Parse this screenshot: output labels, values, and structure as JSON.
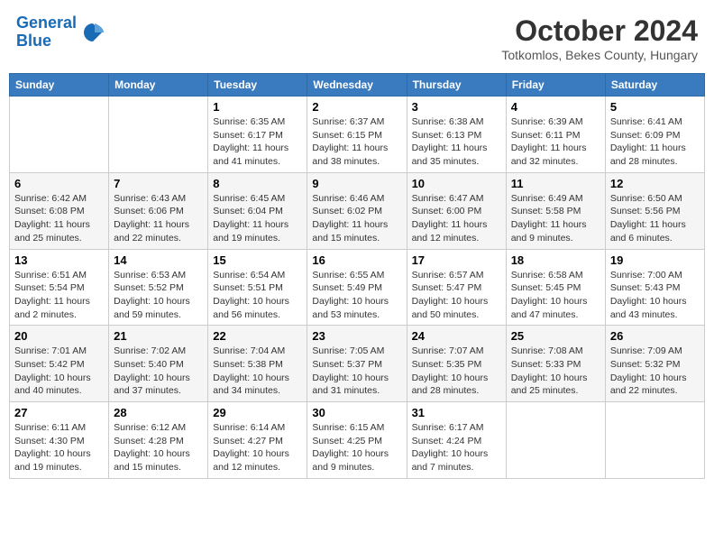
{
  "header": {
    "logo_line1": "General",
    "logo_line2": "Blue",
    "month": "October 2024",
    "location": "Totkomlos, Bekes County, Hungary"
  },
  "weekdays": [
    "Sunday",
    "Monday",
    "Tuesday",
    "Wednesday",
    "Thursday",
    "Friday",
    "Saturday"
  ],
  "weeks": [
    [
      {
        "day": "",
        "info": ""
      },
      {
        "day": "",
        "info": ""
      },
      {
        "day": "1",
        "info": "Sunrise: 6:35 AM\nSunset: 6:17 PM\nDaylight: 11 hours and 41 minutes."
      },
      {
        "day": "2",
        "info": "Sunrise: 6:37 AM\nSunset: 6:15 PM\nDaylight: 11 hours and 38 minutes."
      },
      {
        "day": "3",
        "info": "Sunrise: 6:38 AM\nSunset: 6:13 PM\nDaylight: 11 hours and 35 minutes."
      },
      {
        "day": "4",
        "info": "Sunrise: 6:39 AM\nSunset: 6:11 PM\nDaylight: 11 hours and 32 minutes."
      },
      {
        "day": "5",
        "info": "Sunrise: 6:41 AM\nSunset: 6:09 PM\nDaylight: 11 hours and 28 minutes."
      }
    ],
    [
      {
        "day": "6",
        "info": "Sunrise: 6:42 AM\nSunset: 6:08 PM\nDaylight: 11 hours and 25 minutes."
      },
      {
        "day": "7",
        "info": "Sunrise: 6:43 AM\nSunset: 6:06 PM\nDaylight: 11 hours and 22 minutes."
      },
      {
        "day": "8",
        "info": "Sunrise: 6:45 AM\nSunset: 6:04 PM\nDaylight: 11 hours and 19 minutes."
      },
      {
        "day": "9",
        "info": "Sunrise: 6:46 AM\nSunset: 6:02 PM\nDaylight: 11 hours and 15 minutes."
      },
      {
        "day": "10",
        "info": "Sunrise: 6:47 AM\nSunset: 6:00 PM\nDaylight: 11 hours and 12 minutes."
      },
      {
        "day": "11",
        "info": "Sunrise: 6:49 AM\nSunset: 5:58 PM\nDaylight: 11 hours and 9 minutes."
      },
      {
        "day": "12",
        "info": "Sunrise: 6:50 AM\nSunset: 5:56 PM\nDaylight: 11 hours and 6 minutes."
      }
    ],
    [
      {
        "day": "13",
        "info": "Sunrise: 6:51 AM\nSunset: 5:54 PM\nDaylight: 11 hours and 2 minutes."
      },
      {
        "day": "14",
        "info": "Sunrise: 6:53 AM\nSunset: 5:52 PM\nDaylight: 10 hours and 59 minutes."
      },
      {
        "day": "15",
        "info": "Sunrise: 6:54 AM\nSunset: 5:51 PM\nDaylight: 10 hours and 56 minutes."
      },
      {
        "day": "16",
        "info": "Sunrise: 6:55 AM\nSunset: 5:49 PM\nDaylight: 10 hours and 53 minutes."
      },
      {
        "day": "17",
        "info": "Sunrise: 6:57 AM\nSunset: 5:47 PM\nDaylight: 10 hours and 50 minutes."
      },
      {
        "day": "18",
        "info": "Sunrise: 6:58 AM\nSunset: 5:45 PM\nDaylight: 10 hours and 47 minutes."
      },
      {
        "day": "19",
        "info": "Sunrise: 7:00 AM\nSunset: 5:43 PM\nDaylight: 10 hours and 43 minutes."
      }
    ],
    [
      {
        "day": "20",
        "info": "Sunrise: 7:01 AM\nSunset: 5:42 PM\nDaylight: 10 hours and 40 minutes."
      },
      {
        "day": "21",
        "info": "Sunrise: 7:02 AM\nSunset: 5:40 PM\nDaylight: 10 hours and 37 minutes."
      },
      {
        "day": "22",
        "info": "Sunrise: 7:04 AM\nSunset: 5:38 PM\nDaylight: 10 hours and 34 minutes."
      },
      {
        "day": "23",
        "info": "Sunrise: 7:05 AM\nSunset: 5:37 PM\nDaylight: 10 hours and 31 minutes."
      },
      {
        "day": "24",
        "info": "Sunrise: 7:07 AM\nSunset: 5:35 PM\nDaylight: 10 hours and 28 minutes."
      },
      {
        "day": "25",
        "info": "Sunrise: 7:08 AM\nSunset: 5:33 PM\nDaylight: 10 hours and 25 minutes."
      },
      {
        "day": "26",
        "info": "Sunrise: 7:09 AM\nSunset: 5:32 PM\nDaylight: 10 hours and 22 minutes."
      }
    ],
    [
      {
        "day": "27",
        "info": "Sunrise: 6:11 AM\nSunset: 4:30 PM\nDaylight: 10 hours and 19 minutes."
      },
      {
        "day": "28",
        "info": "Sunrise: 6:12 AM\nSunset: 4:28 PM\nDaylight: 10 hours and 15 minutes."
      },
      {
        "day": "29",
        "info": "Sunrise: 6:14 AM\nSunset: 4:27 PM\nDaylight: 10 hours and 12 minutes."
      },
      {
        "day": "30",
        "info": "Sunrise: 6:15 AM\nSunset: 4:25 PM\nDaylight: 10 hours and 9 minutes."
      },
      {
        "day": "31",
        "info": "Sunrise: 6:17 AM\nSunset: 4:24 PM\nDaylight: 10 hours and 7 minutes."
      },
      {
        "day": "",
        "info": ""
      },
      {
        "day": "",
        "info": ""
      }
    ]
  ]
}
